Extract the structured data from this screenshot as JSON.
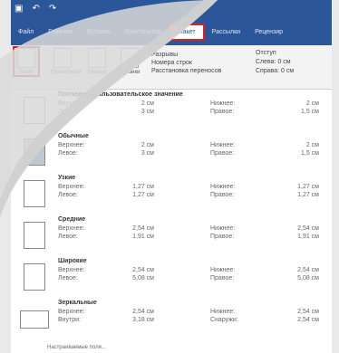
{
  "tabs": [
    "Файл",
    "Главная",
    "Вставка",
    "Конструктор",
    "Макет",
    "Рассылки",
    "Рецензир"
  ],
  "active_tab_index": 4,
  "ribbon": {
    "buttons": [
      "Поля",
      "Ориентация",
      "Размер",
      "Колонки"
    ],
    "lines": [
      "Разрывы",
      "Номера строк",
      "Расстановка переносов"
    ],
    "right_title": "Отступ",
    "right_lines": [
      "Слева: 0 см",
      "Справа: 0 см"
    ]
  },
  "presets": [
    {
      "name": "Последнее пользовательское значение",
      "l1": "Верхнее:",
      "l2": "Левое:",
      "v1": "2 см",
      "v2": "3 см",
      "c1": "Нижнее:",
      "c2": "Правое:",
      "cv1": "2 см",
      "cv2": "1,5 см"
    },
    {
      "name": "Обычные",
      "l1": "Верхнее:",
      "l2": "Левое:",
      "v1": "2 см",
      "v2": "3 см",
      "c1": "Нижнее:",
      "c2": "Правое:",
      "cv1": "2 см",
      "cv2": "1,5 см"
    },
    {
      "name": "Узкие",
      "l1": "Верхнее:",
      "l2": "Левое:",
      "v1": "1,27 см",
      "v2": "1,27 см",
      "c1": "Нижнее:",
      "c2": "Правое:",
      "cv1": "1,27 см",
      "cv2": "1,27 см"
    },
    {
      "name": "Средние",
      "l1": "Верхнее:",
      "l2": "Левое:",
      "v1": "2,54 см",
      "v2": "1,91 см",
      "c1": "Нижнее:",
      "c2": "Правое:",
      "cv1": "2,54 см",
      "cv2": "1,91 см"
    },
    {
      "name": "Широкие",
      "l1": "Верхнее:",
      "l2": "Левое:",
      "v1": "2,54 см",
      "v2": "5,08 см",
      "c1": "Нижнее:",
      "c2": "Правое:",
      "cv1": "2,54 см",
      "cv2": "5,08 см"
    },
    {
      "name": "Зеркальные",
      "l1": "Верхнее:",
      "l2": "Внутри:",
      "v1": "2,54 см",
      "v2": "3,18 см",
      "c1": "Нижнее:",
      "c2": "Снаружи:",
      "cv1": "2,54 см",
      "cv2": "2,54 см"
    }
  ],
  "footer": "Настраиваемые поля..."
}
